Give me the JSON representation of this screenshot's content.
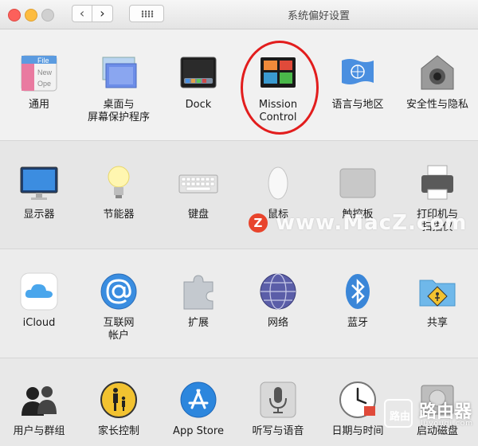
{
  "window": {
    "title": "系统偏好设置",
    "nav_back": "‹",
    "nav_forward": "›"
  },
  "panes": [
    {
      "label": "通用"
    },
    {
      "label": "桌面与\n屏幕保护程序"
    },
    {
      "label": "Dock"
    },
    {
      "label": "Mission\nControl"
    },
    {
      "label": "语言与地区"
    },
    {
      "label": "安全性与隐私"
    },
    {
      "label": "显示器"
    },
    {
      "label": "节能器"
    },
    {
      "label": "键盘"
    },
    {
      "label": "鼠标"
    },
    {
      "label": "触控板"
    },
    {
      "label": "打印机与\n扫描仪"
    },
    {
      "label": "iCloud"
    },
    {
      "label": "互联网\n帐户"
    },
    {
      "label": "扩展"
    },
    {
      "label": "网络"
    },
    {
      "label": "蓝牙"
    },
    {
      "label": "共享"
    },
    {
      "label": "用户与群组"
    },
    {
      "label": "家长控制"
    },
    {
      "label": "App Store"
    },
    {
      "label": "听写与语音"
    },
    {
      "label": "日期与时间"
    },
    {
      "label": "启动磁盘"
    }
  ],
  "icon_texts": {
    "general_file": "File",
    "general_new": "New",
    "general_open": "Ope"
  },
  "watermark": {
    "badge": "Z",
    "text": "www.MacZ.com"
  },
  "corner_logo": {
    "badge": "路由",
    "big": "路由器",
    "small": "luyouqi.com"
  }
}
